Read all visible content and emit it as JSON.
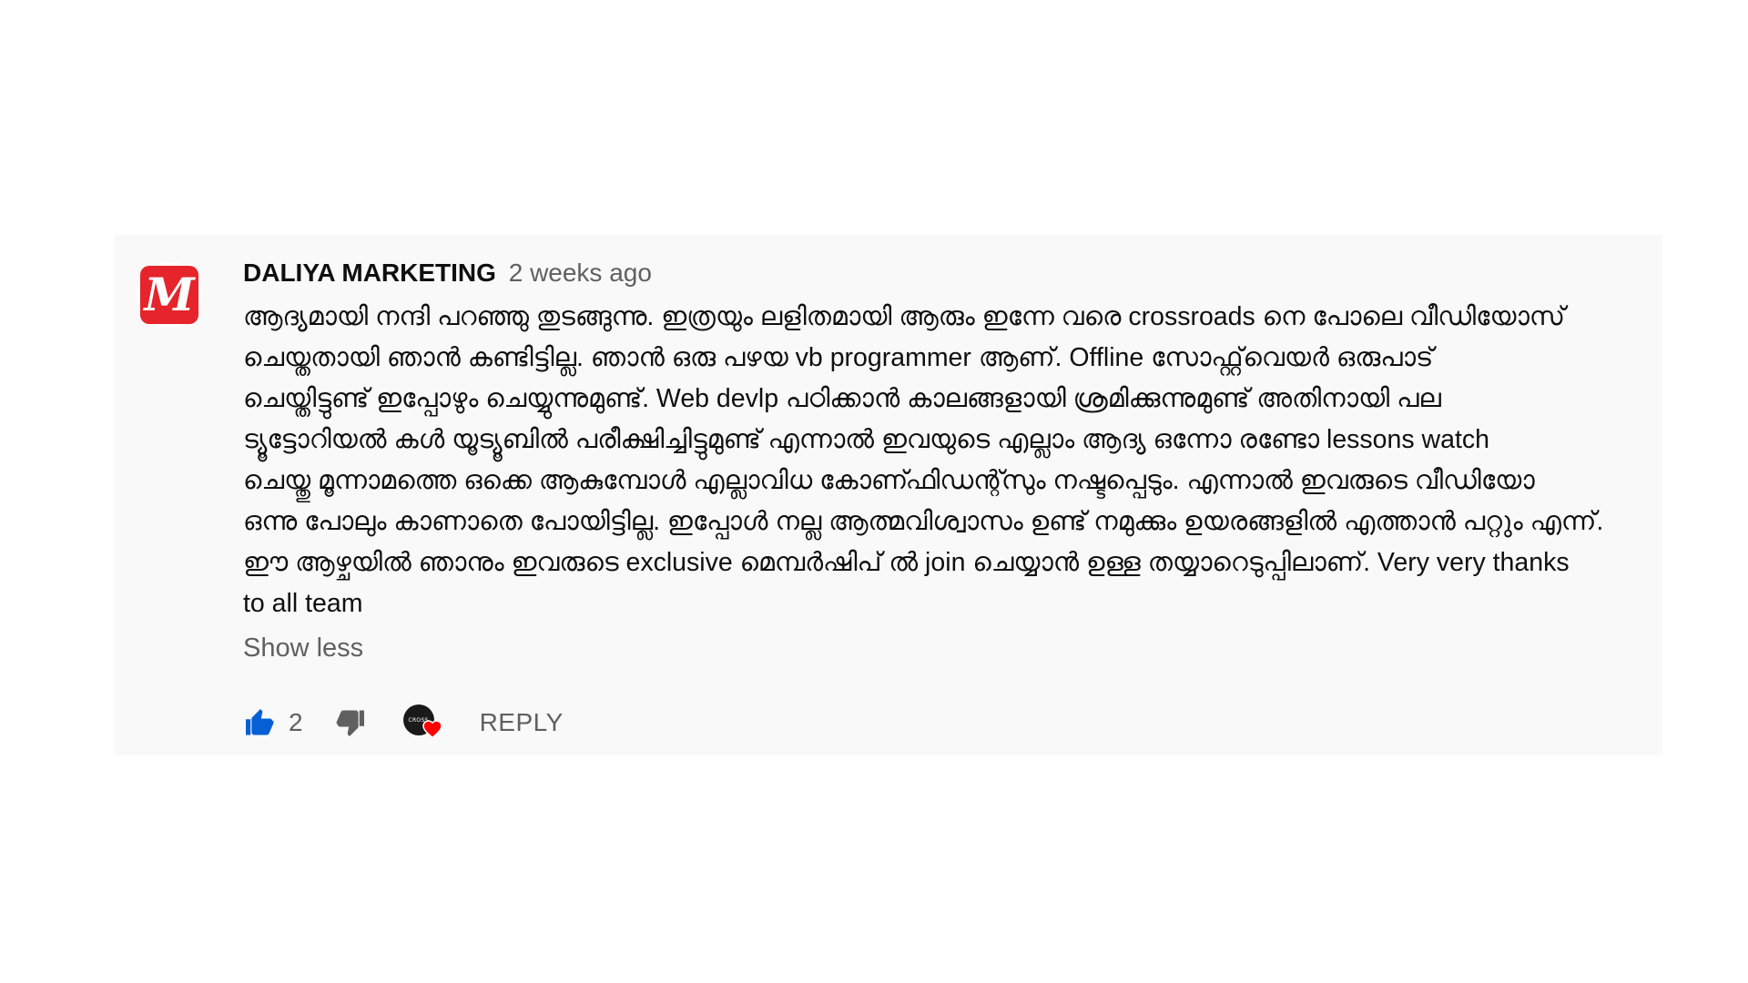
{
  "comment": {
    "author": "DALIYA MARKETING",
    "timestamp": "2 weeks ago",
    "avatar_letter": "M",
    "text_lines": [
      "ആദ്യമായി നന്ദി പറഞ്ഞു തുടങ്ങുന്നു. ഇത്രയും ലളിതമായി ആരും ഇന്നേ വരെ crossroads നെ പോലെ വീഡിയോസ്",
      "ചെയ്തതായി ഞാൻ കണ്ടിട്ടില്ല. ഞാൻ ഒരു പഴയ vb programmer ആണ്. Offline സോഫ്റ്റ്‌വെയർ ഒരുപാട്",
      "ചെയ്തിട്ടുണ്ട് ഇപ്പോഴും ചെയ്യുന്നുമുണ്ട്. Web devlp പഠിക്കാൻ കാലങ്ങളായി ശ്രമിക്കുന്നുമുണ്ട് അതിനായി പല",
      "ട്യൂട്ടോറിയൽ കൾ യൂട്യൂബിൽ പരീക്ഷിച്ചിട്ടുമുണ്ട് എന്നാൽ ഇവയുടെ എല്ലാം ആദ്യ ഒന്നോ രണ്ടോ lessons watch",
      "ചെയ്തു മൂന്നാമത്തെ ഒക്കെ ആകുമ്പോൾ എല്ലാവിധ കോണ്ഫിഡന്റ്സും നഷ്ടപ്പെടും. എന്നാൽ ഇവരുടെ വീഡിയോ",
      "ഒന്നു പോലും കാണാതെ പോയിട്ടില്ല. ഇപ്പോൾ നല്ല ആത്മവിശ്വാസം ഉണ്ട് നമുക്കും ഉയരങ്ങളിൽ എത്താൻ പറ്റും എന്ന്.",
      "ഈ ആഴ്ചയിൽ ഞാനും ഇവരുടെ exclusive മെമ്പർഷിപ് ൽ join ചെയ്യാൻ ഉള്ള തയ്യാറെടുപ്പിലാണ്. Very very thanks",
      "to all team"
    ],
    "show_less_label": "Show less",
    "like_count": "2",
    "creator_heart_label": "CROSS",
    "reply_label": "REPLY"
  },
  "colors": {
    "card_background": "#f9f9f9",
    "avatar_red": "#e5242b",
    "like_active_blue": "#065fd4",
    "icon_gray": "#606060",
    "heart_red": "#ff0000"
  },
  "icons": {
    "like": "thumbs-up-icon",
    "dislike": "thumbs-down-icon",
    "heart": "heart-icon"
  }
}
